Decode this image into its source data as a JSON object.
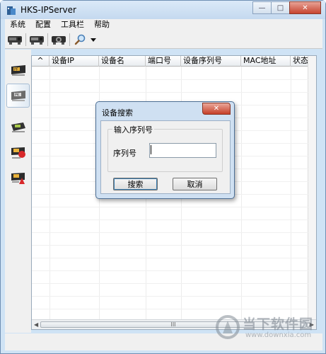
{
  "window": {
    "title": "HKS-IPServer",
    "colors": {
      "frame": "#cfe3f5",
      "close": "#c7442f",
      "panel": "#f0f0f0"
    }
  },
  "menu": [
    "系统",
    "配置",
    "工具栏",
    "帮助"
  ],
  "toolbar": {
    "icons": [
      "device-icon",
      "device-icon",
      "device-config-icon",
      "search-icon",
      "dropdown-arrow-icon"
    ]
  },
  "sidebar": {
    "items": [
      "pf-device-icon",
      "pk-device-icon",
      "network-device-icon",
      "alert-device-icon",
      "warning-device-icon"
    ],
    "active_index": 1
  },
  "table": {
    "sort_indicator": "^",
    "columns": [
      "设备IP",
      "设备名",
      "端口号",
      "设备序列号",
      "MAC地址",
      "状态"
    ],
    "rows": [],
    "hscroll_grip": "III"
  },
  "dialog": {
    "title": "设备搜索",
    "close_label": "✕",
    "group_label": "输入序列号",
    "field_label": "序列号",
    "field_value": "",
    "search_button": "搜索",
    "cancel_button": "取消"
  },
  "watermark": {
    "text": "当下软件园",
    "url": "www.downxia.com"
  }
}
